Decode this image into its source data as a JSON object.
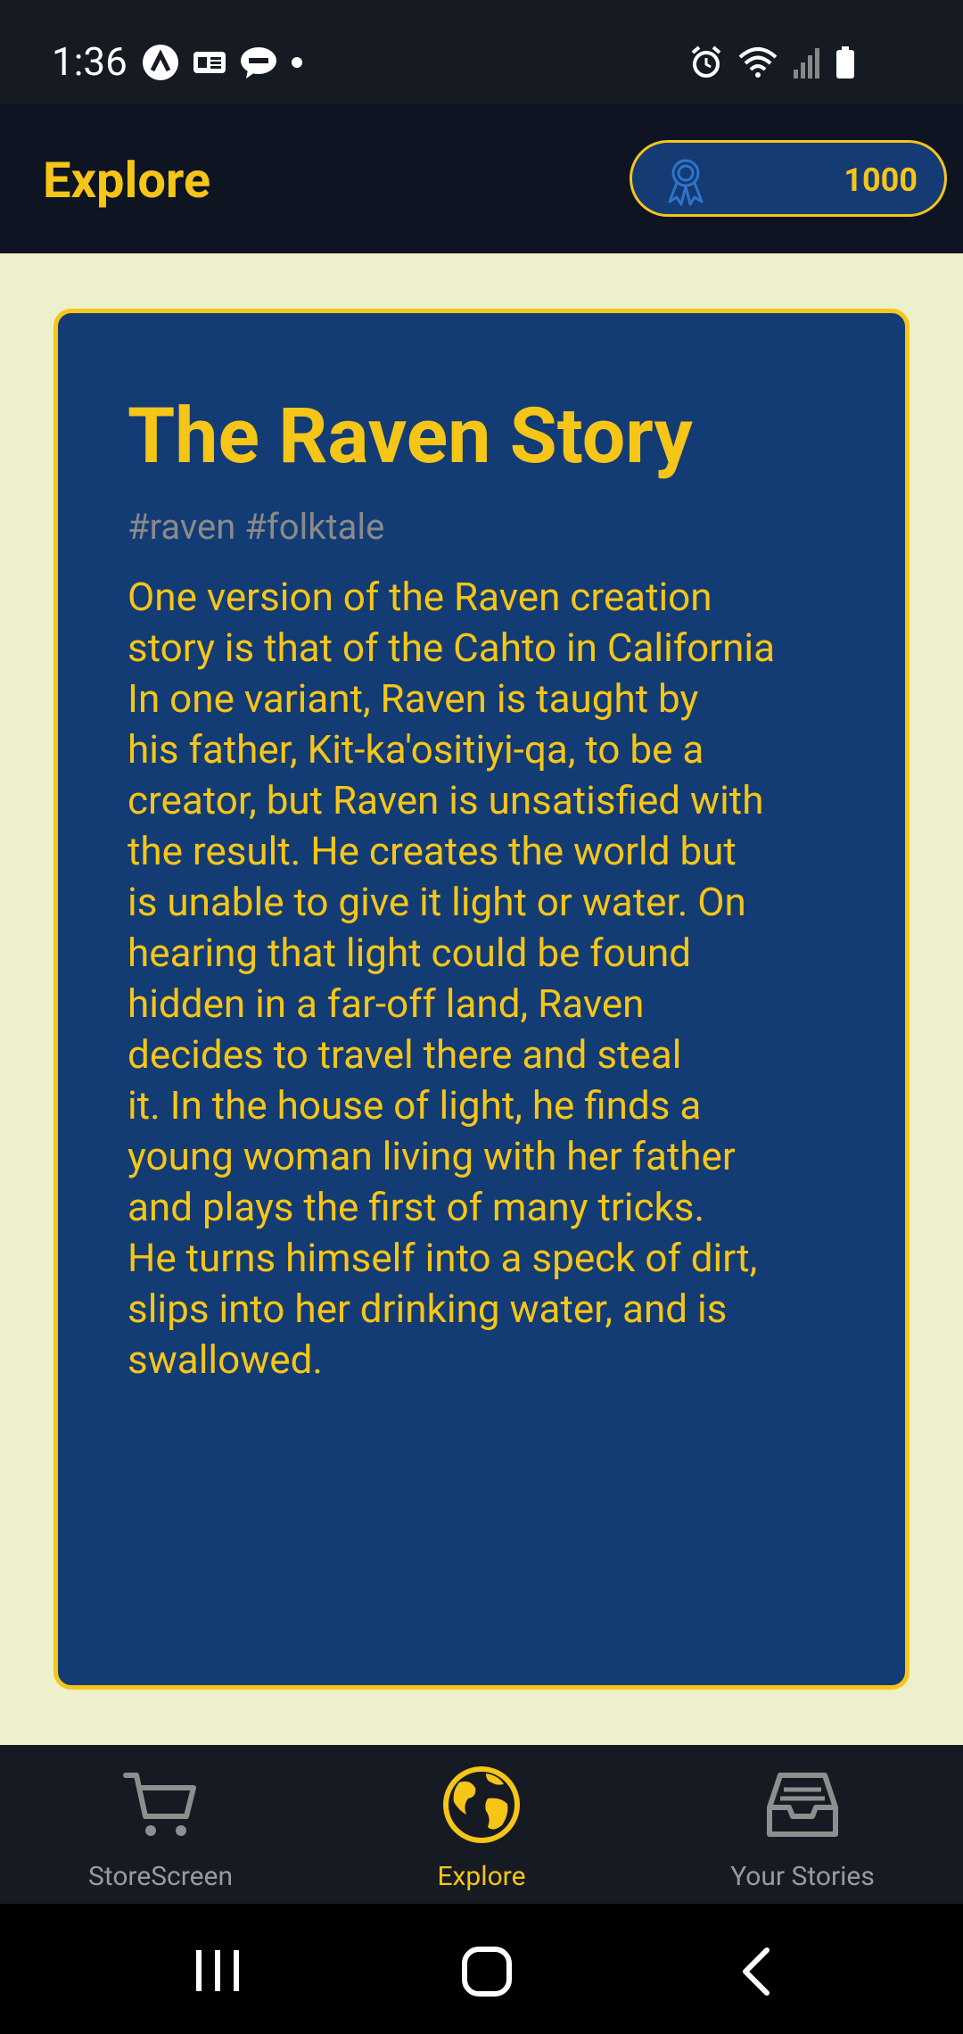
{
  "status_bar": {
    "time": "1:36"
  },
  "header": {
    "title": "Explore",
    "points": "1000"
  },
  "story": {
    "title": "The Raven Story",
    "tags": "#raven #folktale",
    "body_lines": [
      "One version of the Raven creation",
      "story is that of the Cahto in California",
      "In one variant, Raven is taught by",
      "his father, Kit-ka'ositiyi-qa, to be a",
      "creator, but Raven is unsatisfied with",
      "the result. He creates the world but",
      "is unable to give it light or water. On",
      "hearing that light could be found",
      "hidden in a far-off land, Raven",
      "decides to travel there and steal",
      "it. In the house of light, he finds a",
      "young woman living with her father",
      "and plays the first of many tricks.",
      "He turns himself into a speck of dirt,",
      "slips into her drinking water, and is",
      "swallowed."
    ]
  },
  "bottom_nav": {
    "items": [
      {
        "label": "StoreScreen",
        "icon": "cart-icon",
        "active": false
      },
      {
        "label": "Explore",
        "icon": "globe-icon",
        "active": true
      },
      {
        "label": "Your Stories",
        "icon": "inbox-icon",
        "active": false
      }
    ]
  },
  "colors": {
    "accent": "#F5C518",
    "card_bg": "#133C75",
    "page_bg": "#EEEFCB",
    "header_bg": "#0E1422"
  }
}
